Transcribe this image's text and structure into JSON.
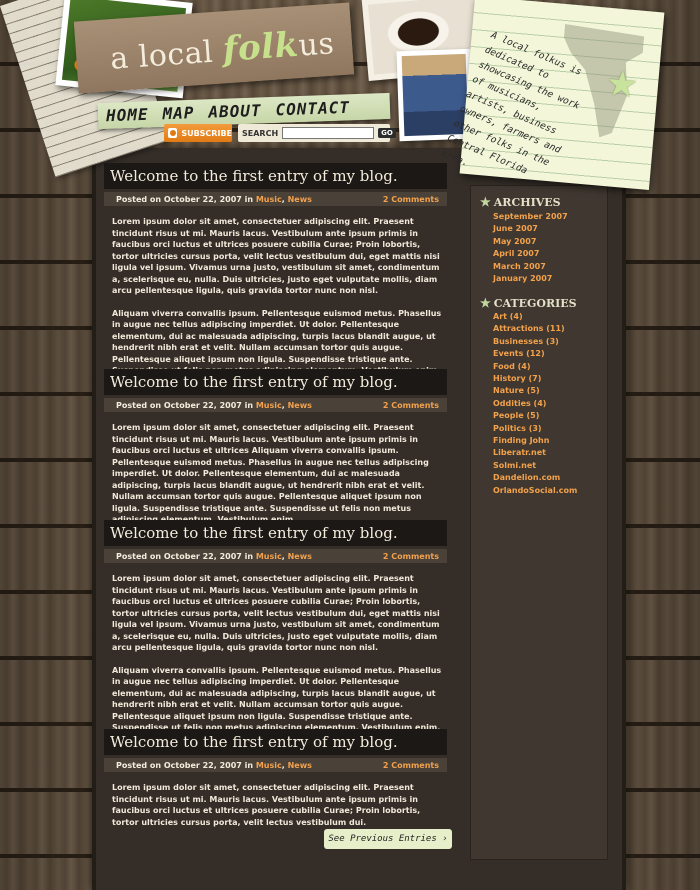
{
  "header": {
    "logo": {
      "part1": "a local ",
      "part2": "folk",
      "part3": "us"
    },
    "note": "A local folkus is dedicated to showcasing the work of musicians, artists, business owners, farmers and other folks in the Central Florida area."
  },
  "nav": {
    "items": [
      "HOME",
      "MAP",
      "ABOUT",
      "CONTACT"
    ]
  },
  "subscribe": {
    "label": "SUBSCRIBE"
  },
  "search": {
    "label": "SEARCH",
    "placeholder": "",
    "button": "GO"
  },
  "posts": [
    {
      "title": "Welcome to the first entry of my blog.",
      "meta_prefix": "Posted on October 22, 2007 in ",
      "cat1": "Music",
      "sep": ", ",
      "cat2": "News",
      "comments": "2 Comments",
      "p1": "Lorem ipsum dolor sit amet, consectetuer adipiscing elit. Praesent tincidunt risus ut mi. Mauris lacus. Vestibulum ante ipsum primis in faucibus orci luctus et ultrices posuere cubilia Curae; Proin lobortis, tortor ultricies cursus porta, velit lectus vestibulum dui, eget mattis nisi ligula vel ipsum. Vivamus urna justo, vestibulum sit amet, condimentum a, scelerisque eu, nulla. Duis ultricies, justo eget vulputate mollis, diam arcu pellentesque ligula, quis gravida tortor nunc non nisl.",
      "p2": "Aliquam viverra convallis ipsum. Pellentesque euismod metus. Phasellus in augue nec tellus adipiscing imperdiet. Ut dolor. Pellentesque elementum, dui ac malesuada adipiscing, turpis lacus blandit augue, ut hendrerit nibh erat et velit. Nullam accumsan tortor quis augue. Pellentesque aliquet ipsum non ligula. Suspendisse tristique ante. Suspendisse ut felis non metus adipiscing elementum. Vestibulum enim."
    },
    {
      "title": "Welcome to the first entry of my blog.",
      "meta_prefix": "Posted on October 22, 2007 in ",
      "cat1": "Music",
      "sep": ", ",
      "cat2": "News",
      "comments": "2 Comments",
      "p1": "Lorem ipsum dolor sit amet, consectetuer adipiscing elit. Praesent tincidunt risus ut mi. Mauris lacus. Vestibulum ante ipsum primis in faucibus orci luctus et ultrices Aliquam viverra convallis ipsum. Pellentesque euismod metus. Phasellus in augue nec tellus adipiscing imperdiet. Ut dolor. Pellentesque elementum, dui ac malesuada adipiscing, turpis lacus blandit augue, ut hendrerit nibh erat et velit. Nullam accumsan tortor quis augue. Pellentesque aliquet ipsum non ligula. Suspendisse tristique ante. Suspendisse ut felis non metus adipiscing elementum. Vestibulum enim.",
      "p2": ""
    },
    {
      "title": "Welcome to the first entry of my blog.",
      "meta_prefix": "Posted on October 22, 2007 in ",
      "cat1": "Music",
      "sep": ", ",
      "cat2": "News",
      "comments": "2 Comments",
      "p1": "Lorem ipsum dolor sit amet, consectetuer adipiscing elit. Praesent tincidunt risus ut mi. Mauris lacus. Vestibulum ante ipsum primis in faucibus orci luctus et ultrices posuere cubilia Curae; Proin lobortis, tortor ultricies cursus porta, velit lectus vestibulum dui, eget mattis nisi ligula vel ipsum. Vivamus urna justo, vestibulum sit amet, condimentum a, scelerisque eu, nulla. Duis ultricies, justo eget vulputate mollis, diam arcu pellentesque ligula, quis gravida tortor nunc non nisl.",
      "p2": "Aliquam viverra convallis ipsum. Pellentesque euismod metus. Phasellus in augue nec tellus adipiscing imperdiet. Ut dolor. Pellentesque elementum, dui ac malesuada adipiscing, turpis lacus blandit augue, ut hendrerit nibh erat et velit. Nullam accumsan tortor quis augue. Pellentesque aliquet ipsum non ligula. Suspendisse tristique ante. Suspendisse ut felis non metus adipiscing elementum. Vestibulum enim."
    },
    {
      "title": "Welcome to the first entry of my blog.",
      "meta_prefix": "Posted on October 22, 2007 in ",
      "cat1": "Music",
      "sep": ", ",
      "cat2": "News",
      "comments": "2 Comments",
      "p1": "Lorem ipsum dolor sit amet, consectetuer adipiscing elit. Praesent tincidunt risus ut mi. Mauris lacus. Vestibulum ante ipsum primis in faucibus orci luctus et ultrices posuere cubilia Curae; Proin lobortis, tortor ultricies cursus porta, velit lectus vestibulum dui.",
      "p2": ""
    }
  ],
  "prev_entries": "See Previous Entries",
  "sidebar": {
    "archives_title": "ARCHIVES",
    "archives": [
      "September 2007",
      "June 2007",
      "May 2007",
      "April 2007",
      "March 2007",
      "January 2007"
    ],
    "categories_title": "CATEGORIES",
    "categories": [
      "Art (4)",
      "Attractions (11)",
      "Businesses (3)",
      "Events (12)",
      "Food (4)",
      "History (7)",
      "Nature (5)",
      "Oddities (4)",
      "People (5)",
      "Politics (3)",
      "Finding John",
      "Liberatr.net",
      "Solmi.net",
      "Dandelion.com",
      "OrlandoSocial.com"
    ]
  }
}
